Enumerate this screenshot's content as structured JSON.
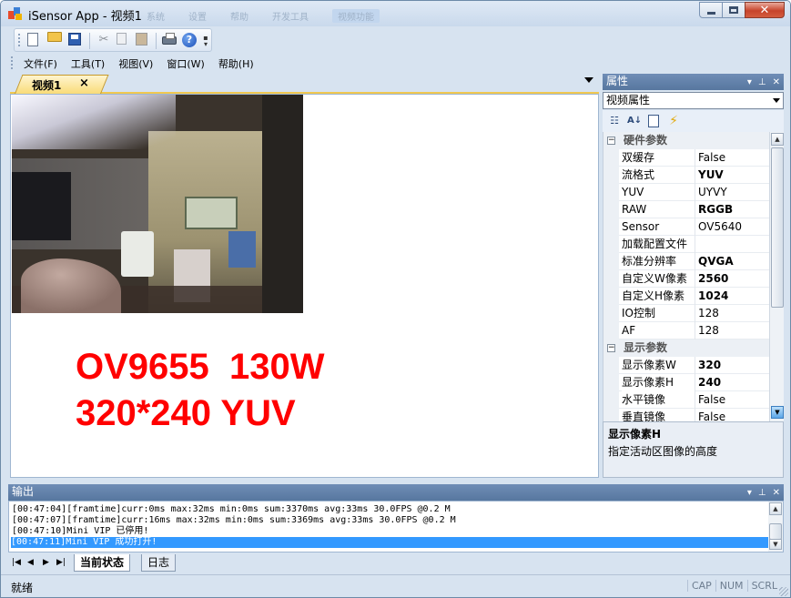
{
  "window": {
    "title": "iSensor App - 视频1",
    "ghost_tabs": [
      "系统",
      "设置",
      "帮助",
      "开发工具",
      "视频功能"
    ]
  },
  "menu": [
    "文件(F)",
    "工具(T)",
    "视图(V)",
    "窗口(W)",
    "帮助(H)"
  ],
  "document": {
    "tab_label": "视频1",
    "tab_close": "×",
    "overlay_line1": "OV9655  130W",
    "overlay_line2": "320*240 YUV"
  },
  "properties": {
    "header": "属性",
    "combo_value": "视频属性",
    "categories": [
      {
        "name": "硬件参数",
        "rows": [
          {
            "name": "双缓存",
            "value": "False",
            "bold": false
          },
          {
            "name": "流格式",
            "value": "YUV",
            "bold": true
          },
          {
            "name": "YUV",
            "value": "UYVY",
            "bold": false
          },
          {
            "name": "RAW",
            "value": "RGGB",
            "bold": true
          },
          {
            "name": "Sensor",
            "value": "OV5640",
            "bold": false
          },
          {
            "name": "加载配置文件",
            "value": "",
            "bold": false
          },
          {
            "name": "标准分辨率",
            "value": "QVGA",
            "bold": true
          },
          {
            "name": "自定义W像素",
            "value": "2560",
            "bold": true
          },
          {
            "name": "自定义H像素",
            "value": "1024",
            "bold": true
          },
          {
            "name": "IO控制",
            "value": "128",
            "bold": false
          },
          {
            "name": "AF",
            "value": "128",
            "bold": false
          }
        ]
      },
      {
        "name": "显示参数",
        "rows": [
          {
            "name": "显示像素W",
            "value": "320",
            "bold": true
          },
          {
            "name": "显示像素H",
            "value": "240",
            "bold": true
          },
          {
            "name": "水平镜像",
            "value": "False",
            "bold": false
          },
          {
            "name": "垂直镜像",
            "value": "False",
            "bold": false
          }
        ]
      }
    ],
    "description_title": "显示像素H",
    "description_text": "指定活动区图像的高度"
  },
  "output": {
    "header": "输出",
    "lines": [
      "[00:47:04][framtime]curr:0ms max:32ms min:0ms sum:3370ms avg:33ms 30.0FPS @0.2 M",
      "[00:47:07][framtime]curr:16ms max:32ms min:0ms sum:3369ms avg:33ms 30.0FPS @0.2 M",
      "[00:47:10]Mini VIP 已停用!",
      "[00:47:11]Mini VIP 成功打开!"
    ],
    "selected_index": 3,
    "tabs": [
      "当前状态",
      "日志"
    ]
  },
  "status": {
    "text": "就绪",
    "indicators": [
      "CAP",
      "NUM",
      "SCRL"
    ]
  },
  "colors": {
    "overlay_text": "#ff0000",
    "selection": "#3399ff",
    "panel_header": "#6383ad",
    "active_tab": "#f9db78"
  }
}
